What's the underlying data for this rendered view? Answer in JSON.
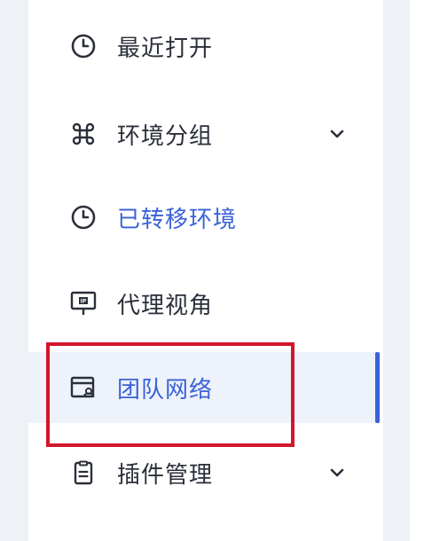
{
  "nav": {
    "items": [
      {
        "label": "最近打开",
        "icon": "clock-icon",
        "has_chevron": false,
        "state": "normal"
      },
      {
        "label": "环境分组",
        "icon": "command-grid-icon",
        "has_chevron": true,
        "state": "normal"
      },
      {
        "label": "已转移环境",
        "icon": "clock-icon",
        "has_chevron": false,
        "state": "blue-text"
      },
      {
        "label": "代理视角",
        "icon": "ip-monitor-icon",
        "has_chevron": false,
        "state": "normal"
      },
      {
        "label": "团队网络",
        "icon": "team-network-icon",
        "has_chevron": false,
        "state": "selected"
      },
      {
        "label": "插件管理",
        "icon": "clipboard-icon",
        "has_chevron": true,
        "state": "normal"
      }
    ]
  },
  "colors": {
    "text": "#2b2f3a",
    "accent": "#3a62d6",
    "selected_bg": "#eef2fb",
    "highlight_border": "#d2162b",
    "page_bg": "#eef1f6"
  },
  "icon_text": {
    "ip": "IP"
  }
}
